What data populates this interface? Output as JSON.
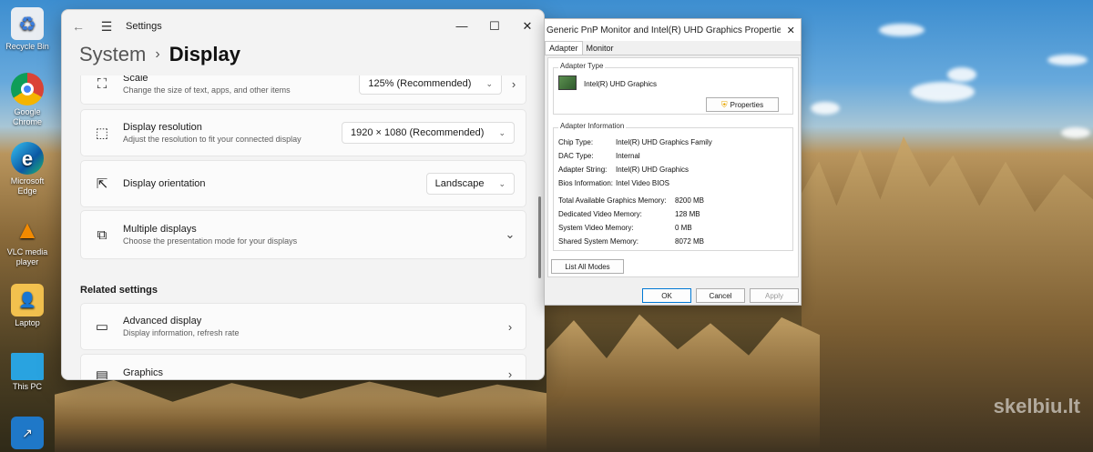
{
  "desktop": {
    "icons": [
      {
        "label": "Recycle Bin",
        "icon": "recycle-bin-icon"
      },
      {
        "label": "Google Chrome",
        "icon": "chrome-icon"
      },
      {
        "label": "Microsoft Edge",
        "icon": "edge-icon"
      },
      {
        "label": "VLC media player",
        "icon": "vlc-icon"
      },
      {
        "label": "Laptop",
        "icon": "folder-icon"
      },
      {
        "label": "This PC",
        "icon": "monitor-icon"
      },
      {
        "label": "",
        "icon": "remote-desktop-icon"
      }
    ],
    "watermark": "skelbiu.lt"
  },
  "settings": {
    "title": "Settings",
    "breadcrumb": {
      "parent": "System",
      "separator": "›",
      "current": "Display"
    },
    "items": {
      "scale": {
        "label": "Scale",
        "desc": "Change the size of text, apps, and other items",
        "value": "125% (Recommended)"
      },
      "resolution": {
        "label": "Display resolution",
        "desc": "Adjust the resolution to fit your connected display",
        "value": "1920 × 1080 (Recommended)"
      },
      "orientation": {
        "label": "Display orientation",
        "value": "Landscape"
      },
      "multiple": {
        "label": "Multiple displays",
        "desc": "Choose the presentation mode for your displays"
      }
    },
    "related_title": "Related settings",
    "related": {
      "advanced": {
        "label": "Advanced display",
        "desc": "Display information, refresh rate"
      },
      "graphics": {
        "label": "Graphics"
      }
    }
  },
  "properties": {
    "title": "Generic PnP Monitor and Intel(R) UHD Graphics Properties",
    "tabs": {
      "adapter": "Adapter",
      "monitor": "Monitor"
    },
    "adapter_type_legend": "Adapter Type",
    "adapter_name": "Intel(R) UHD Graphics",
    "properties_btn": "Properties",
    "info_legend": "Adapter Information",
    "info": [
      {
        "k": "Chip Type:",
        "v": "Intel(R) UHD Graphics Family"
      },
      {
        "k": "DAC Type:",
        "v": "Internal"
      },
      {
        "k": "Adapter String:",
        "v": "Intel(R) UHD Graphics"
      },
      {
        "k": "Bios Information:",
        "v": "Intel Video BIOS"
      }
    ],
    "memory": [
      {
        "k": "Total Available Graphics Memory:",
        "v": "8200 MB"
      },
      {
        "k": "Dedicated Video Memory:",
        "v": "128 MB"
      },
      {
        "k": "System Video Memory:",
        "v": "0 MB"
      },
      {
        "k": "Shared System Memory:",
        "v": "8072 MB"
      }
    ],
    "list_modes_btn": "List All Modes",
    "ok": "OK",
    "cancel": "Cancel",
    "apply": "Apply"
  }
}
